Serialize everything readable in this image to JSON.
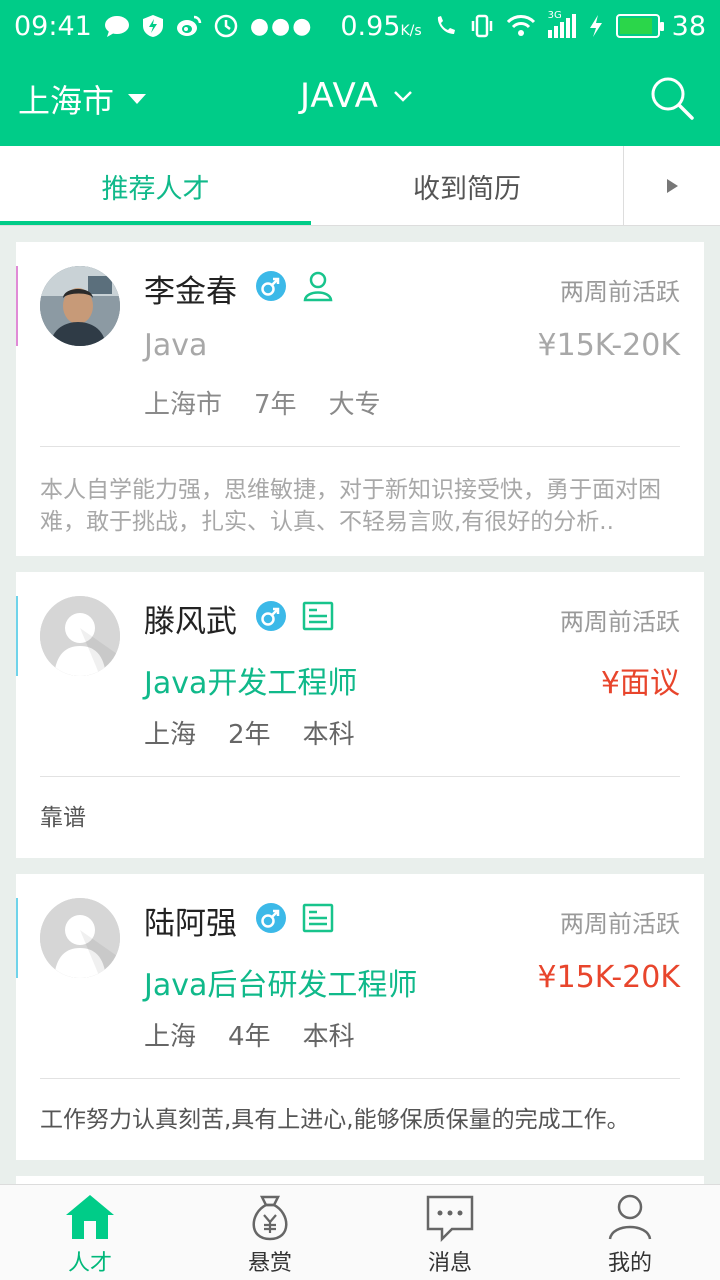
{
  "status_bar": {
    "time": "09:41",
    "speed": "0.95",
    "speed_unit": "K/s",
    "network": "3G",
    "battery": "38"
  },
  "header": {
    "city": "上海市",
    "keyword": "JAVA"
  },
  "tabs": [
    {
      "label": "推荐人才",
      "active": true
    },
    {
      "label": "收到简历",
      "active": false
    }
  ],
  "candidates": [
    {
      "name": "李金春",
      "active": "两周前活跃",
      "title": "Java",
      "salary": "¥15K-20K",
      "city": "上海市",
      "experience": "7年",
      "education": "大专",
      "summary": "本人自学能力强，思维敏捷，对于新知识接受快，勇于面对困难，敢于挑战，扎实、认真、不轻易言败,有很好的分析..",
      "gender_icon": "male-icon",
      "type_icon": "person-icon",
      "bar_color": "#e08ad6"
    },
    {
      "name": "滕风武",
      "active": "两周前活跃",
      "title": "Java开发工程师",
      "salary": "¥面议",
      "city": "上海",
      "experience": "2年",
      "education": "本科",
      "summary": "靠谱",
      "gender_icon": "male-icon",
      "type_icon": "resume-icon",
      "bar_color": "#6fd3ea"
    },
    {
      "name": "陆阿强",
      "active": "两周前活跃",
      "title": "Java后台研发工程师",
      "salary": "¥15K-20K",
      "city": "上海",
      "experience": "4年",
      "education": "本科",
      "summary": "工作努力认真刻苦,具有上进心,能够保质保量的完成工作。",
      "gender_icon": "male-icon",
      "type_icon": "resume-icon",
      "bar_color": "#6fd3ea"
    }
  ],
  "bottom_nav": [
    {
      "label": "人才",
      "icon": "home-icon",
      "active": true
    },
    {
      "label": "悬赏",
      "icon": "money-bag-icon",
      "active": false
    },
    {
      "label": "消息",
      "icon": "message-icon",
      "active": false
    },
    {
      "label": "我的",
      "icon": "profile-icon",
      "active": false
    }
  ],
  "colors": {
    "brand": "#00cc88",
    "accent_text": "#10b98a",
    "salary_red": "#e8452c",
    "male_badge": "#3cb9e8"
  }
}
